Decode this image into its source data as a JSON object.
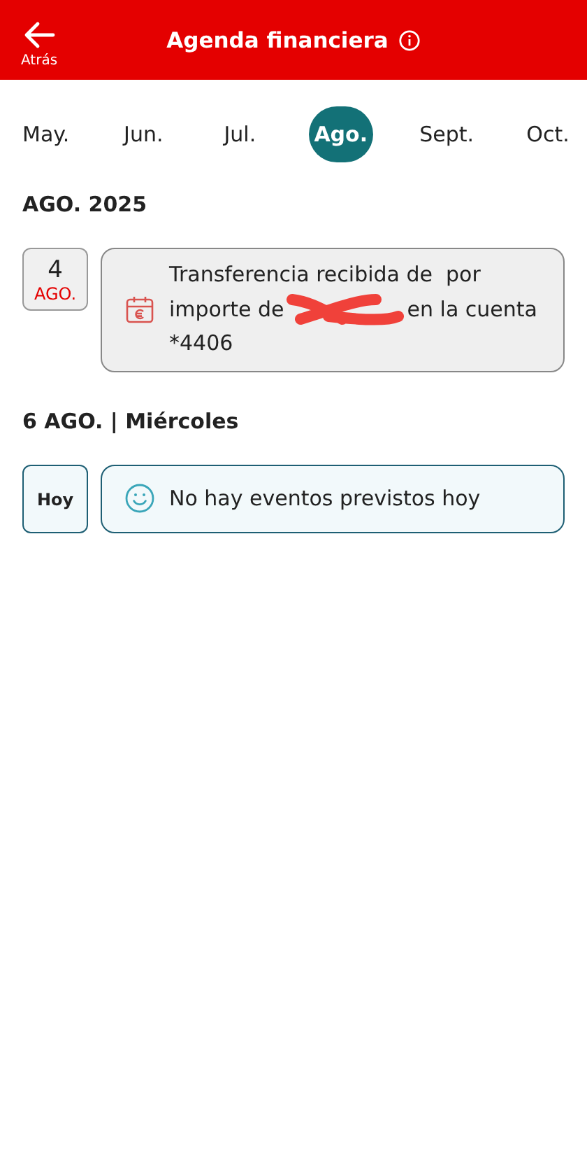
{
  "header": {
    "back_label": "Atrás",
    "title": "Agenda financiera"
  },
  "months": [
    {
      "label": "May.",
      "selected": false
    },
    {
      "label": "Jun.",
      "selected": false
    },
    {
      "label": "Jul.",
      "selected": false
    },
    {
      "label": "Ago.",
      "selected": true
    },
    {
      "label": "Sept.",
      "selected": false
    },
    {
      "label": "Oct.",
      "selected": false
    }
  ],
  "sections": [
    {
      "heading": "AGO. 2025",
      "events": [
        {
          "kind": "transfer",
          "day": "4",
          "month": "AGO.",
          "line_1": "Transferencia recibida de  por",
          "text_before": "importe de",
          "redacted": true,
          "text_after": "en la cuenta",
          "line_3": "*4406"
        }
      ]
    },
    {
      "heading": "6 AGO. | Miércoles",
      "events": [
        {
          "kind": "empty",
          "day": "Hoy",
          "text_before": "No hay eventos previstos hoy"
        }
      ]
    }
  ]
}
